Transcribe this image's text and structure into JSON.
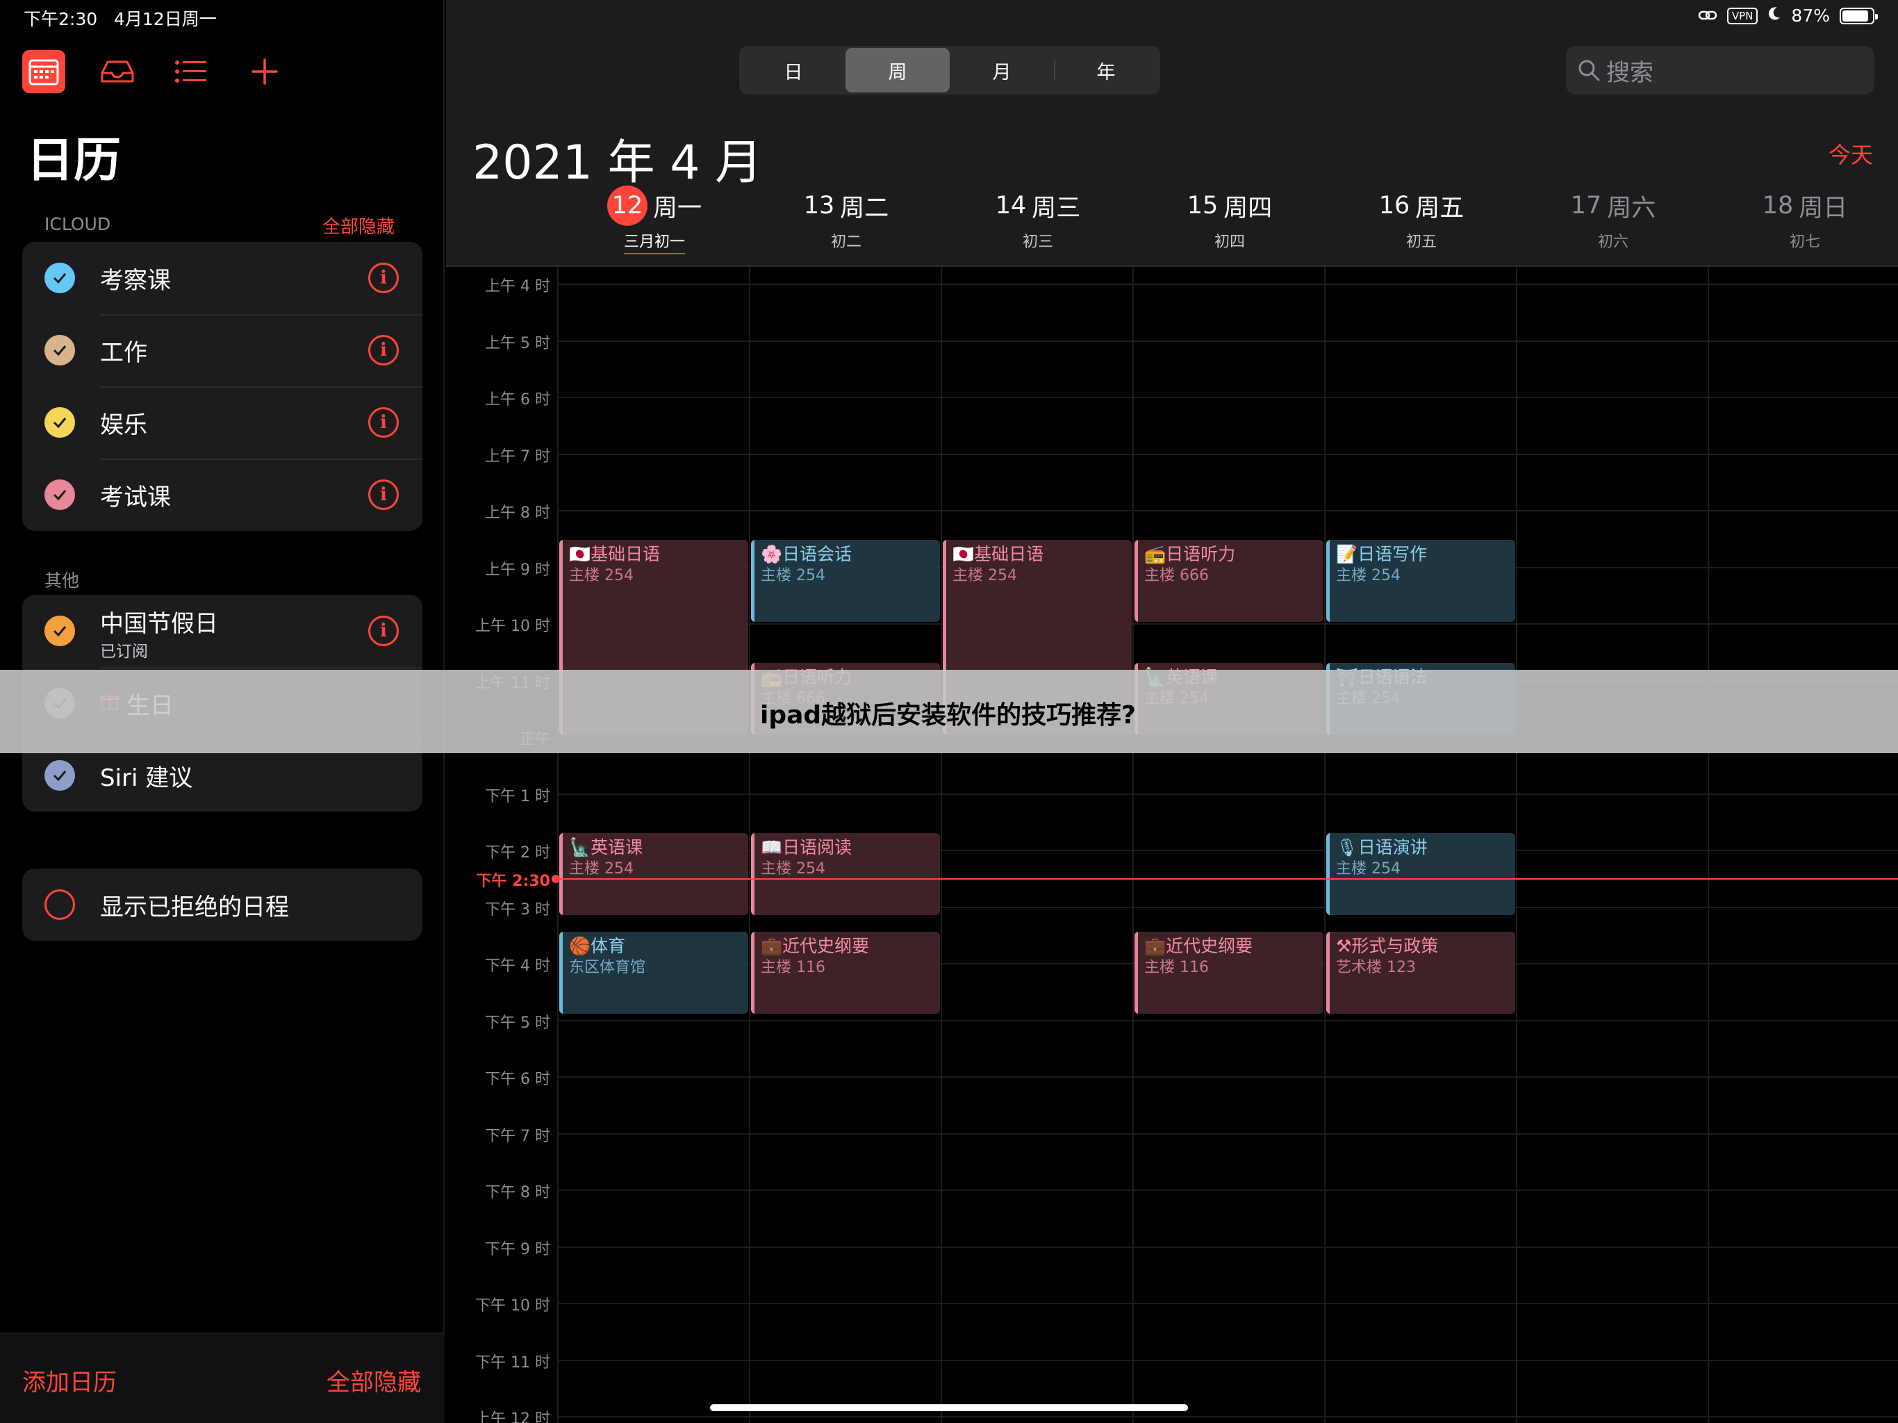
{
  "status": {
    "time": "下午2:30",
    "date": "4月12日周一",
    "vpn": "VPN",
    "battery": "87%",
    "battery_level": 0.87
  },
  "sidebar": {
    "title": "日历",
    "icloud_header": "ICLOUD",
    "icloud_action": "全部隐藏",
    "icloud_items": [
      {
        "label": "考察课",
        "color": "#64c8f5"
      },
      {
        "label": "工作",
        "color": "#d9b48a"
      },
      {
        "label": "娱乐",
        "color": "#f5d65a"
      },
      {
        "label": "考试课",
        "color": "#e8869a"
      }
    ],
    "other_header": "其他",
    "other_items": [
      {
        "label": "中国节假日",
        "sub": "已订阅",
        "color": "#f5a040"
      },
      {
        "label": "生日",
        "color": "#8e8e93"
      },
      {
        "label": "Siri 建议",
        "color": "#8e9ec8"
      }
    ],
    "declined_label": "显示已拒绝的日程",
    "footer_left": "添加日历",
    "footer_right": "全部隐藏"
  },
  "toolbar": {
    "segments": [
      "日",
      "周",
      "月",
      "年"
    ],
    "active_segment": "周",
    "search_placeholder": "搜索"
  },
  "header": {
    "month_title": "2021 年 4 月",
    "today_button": "今天"
  },
  "days": [
    {
      "num": "12",
      "weekday": "周一",
      "lunar": "三月初一",
      "today": true
    },
    {
      "num": "13",
      "weekday": "周二",
      "lunar": "初二"
    },
    {
      "num": "14",
      "weekday": "周三",
      "lunar": "初三"
    },
    {
      "num": "15",
      "weekday": "周四",
      "lunar": "初四"
    },
    {
      "num": "16",
      "weekday": "周五",
      "lunar": "初五"
    },
    {
      "num": "17",
      "weekday": "周六",
      "lunar": "初六",
      "weekend": true
    },
    {
      "num": "18",
      "weekday": "周日",
      "lunar": "初七",
      "weekend": true
    }
  ],
  "hours": [
    "上午 4 时",
    "上午 5 时",
    "上午 6 时",
    "上午 7 时",
    "上午 8 时",
    "上午 9 时",
    "上午 10 时",
    "上午 11 时",
    "正午",
    "下午 1 时",
    "下午 2 时",
    "下午 3 时",
    "下午 4 时",
    "下午 5 时",
    "下午 6 时",
    "下午 7 时",
    "下午 8 时",
    "下午 9 时",
    "下午 10 时",
    "下午 11 时",
    "上午 12 时"
  ],
  "now_label": "下午 2:30",
  "now_hour": 14.5,
  "events": [
    {
      "day": 0,
      "start": 8.5,
      "end": 12.0,
      "title": "🇯🇵基础日语",
      "loc": "主楼 254",
      "color": "pink"
    },
    {
      "day": 1,
      "start": 8.5,
      "end": 10.0,
      "title": "🌸日语会话",
      "loc": "主楼 254",
      "color": "blue"
    },
    {
      "day": 1,
      "start": 10.67,
      "end": 12.0,
      "title": "📻日语听力",
      "loc": "主楼 666",
      "color": "pink"
    },
    {
      "day": 2,
      "start": 8.5,
      "end": 12.0,
      "title": "🇯🇵基础日语",
      "loc": "主楼 254",
      "color": "pink"
    },
    {
      "day": 3,
      "start": 8.5,
      "end": 10.0,
      "title": "📻日语听力",
      "loc": "主楼 666",
      "color": "pink"
    },
    {
      "day": 3,
      "start": 10.67,
      "end": 12.0,
      "title": "🗽英语课",
      "loc": "主楼 254",
      "color": "pink"
    },
    {
      "day": 4,
      "start": 8.5,
      "end": 10.0,
      "title": "📝日语写作",
      "loc": "主楼 254",
      "color": "blue"
    },
    {
      "day": 4,
      "start": 10.67,
      "end": 12.0,
      "title": "⛩日语语法",
      "loc": "主楼 254",
      "color": "blue"
    },
    {
      "day": 0,
      "start": 13.67,
      "end": 15.17,
      "title": "🗽英语课",
      "loc": "主楼 254",
      "color": "pink"
    },
    {
      "day": 1,
      "start": 13.67,
      "end": 15.17,
      "title": "📖日语阅读",
      "loc": "主楼 254",
      "color": "pink"
    },
    {
      "day": 4,
      "start": 13.67,
      "end": 15.17,
      "title": "🎙日语演讲",
      "loc": "主楼 254",
      "color": "blue"
    },
    {
      "day": 0,
      "start": 15.42,
      "end": 16.92,
      "title": "🏀体育",
      "loc": "东区体育馆",
      "color": "blue"
    },
    {
      "day": 1,
      "start": 15.42,
      "end": 16.92,
      "title": "💼近代史纲要",
      "loc": "主楼 116",
      "color": "pink"
    },
    {
      "day": 3,
      "start": 15.42,
      "end": 16.92,
      "title": "💼近代史纲要",
      "loc": "主楼 116",
      "color": "pink"
    },
    {
      "day": 4,
      "start": 15.42,
      "end": 16.92,
      "title": "⚒形式与政策",
      "loc": "艺术楼 123",
      "color": "pink"
    }
  ],
  "banner": {
    "text": "ipad越狱后安装软件的技巧推荐?"
  }
}
